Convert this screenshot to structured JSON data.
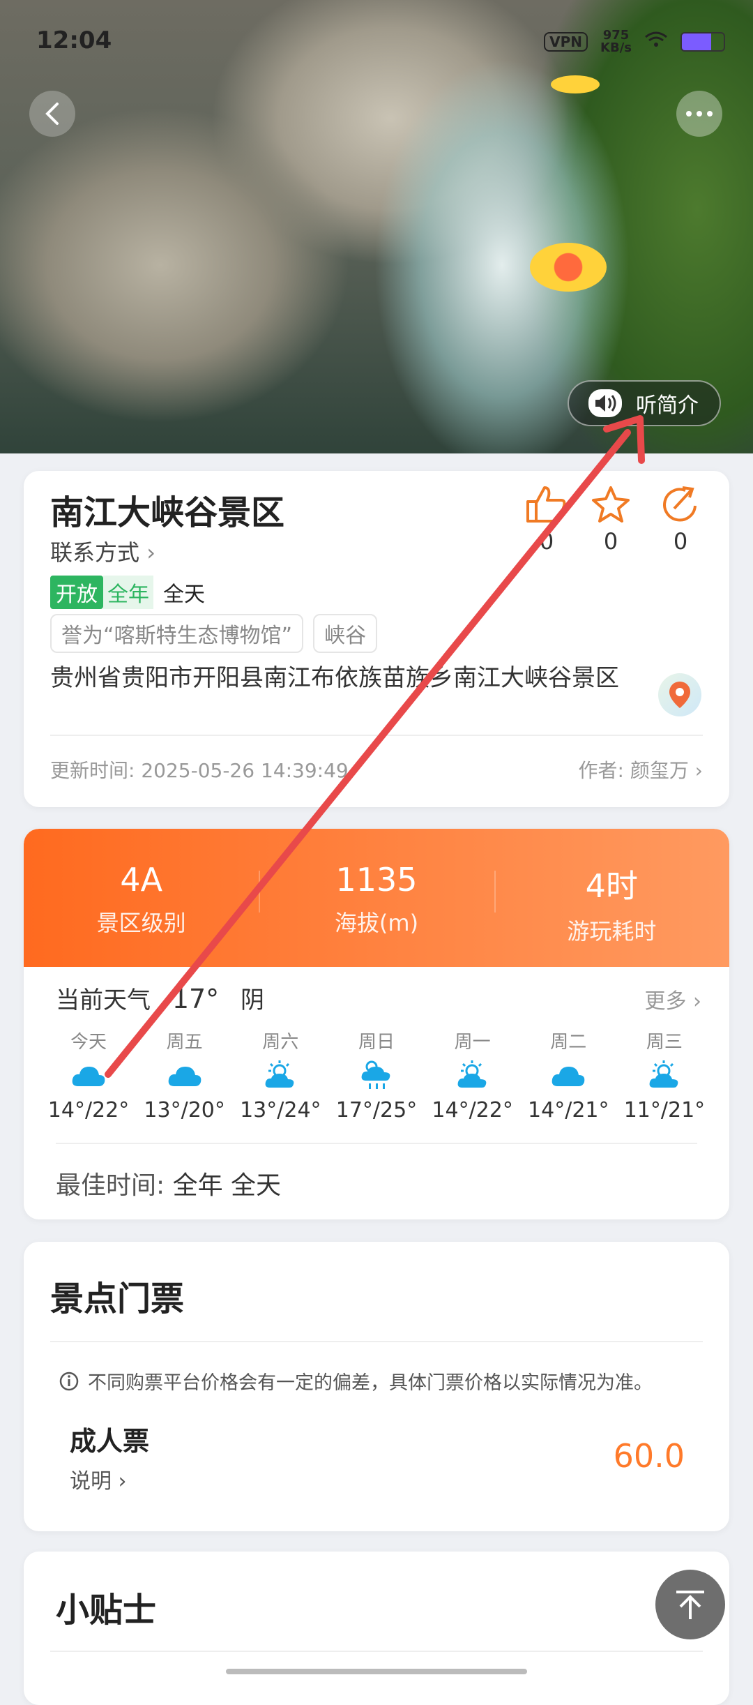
{
  "status_bar": {
    "time": "12:04",
    "vpn": "VPN",
    "speed": "975",
    "speed_unit": "KB/s"
  },
  "hero": {
    "audio_label": "听简介"
  },
  "spot": {
    "name": "南江大峡谷景区",
    "contact": "联系方式",
    "open_tag": "开放",
    "season": "全年",
    "hours": "全天",
    "chips": [
      "誉为“喀斯特生态博物馆”",
      "峡谷"
    ],
    "address": "贵州省贵阳市开阳县南江布依族苗族乡南江大峡谷景区",
    "updated": "更新时间: 2025-05-26 14:39:49",
    "author": "作者: 颜玺万",
    "like_count": "0",
    "fav_count": "0",
    "share_count": "0"
  },
  "stats": [
    {
      "value": "4A",
      "label": "景区级别"
    },
    {
      "value": "1135",
      "label": "海拔(m)"
    },
    {
      "value": "4时",
      "label": "游玩耗时"
    }
  ],
  "weather": {
    "label": "当前天气",
    "temp": "17°",
    "cond": "阴",
    "more": "更多",
    "days": [
      {
        "name": "今天",
        "range": "14°/22°",
        "icon": "cloud-icon"
      },
      {
        "name": "周五",
        "range": "13°/20°",
        "icon": "cloud-icon"
      },
      {
        "name": "周六",
        "range": "13°/24°",
        "icon": "partly-sunny-icon"
      },
      {
        "name": "周日",
        "range": "17°/25°",
        "icon": "sun-rain-icon"
      },
      {
        "name": "周一",
        "range": "14°/22°",
        "icon": "partly-sunny-icon"
      },
      {
        "name": "周二",
        "range": "14°/21°",
        "icon": "cloud-icon"
      },
      {
        "name": "周三",
        "range": "11°/21°",
        "icon": "partly-sunny-icon"
      }
    ],
    "best_label": "最佳时间:",
    "best_value": "全年 全天"
  },
  "tickets": {
    "title": "景点门票",
    "notice": "不同购票平台价格会有一定的偏差，具体门票价格以实际情况为准。",
    "name": "成人票",
    "desc": "说明",
    "price": "60.0"
  },
  "tips": {
    "title": "小贴士"
  },
  "colors": {
    "accent": "#ff7a2a",
    "open_green": "#2db560",
    "weather_blue": "#1aa7e6",
    "annotation_red": "#e8494a"
  }
}
